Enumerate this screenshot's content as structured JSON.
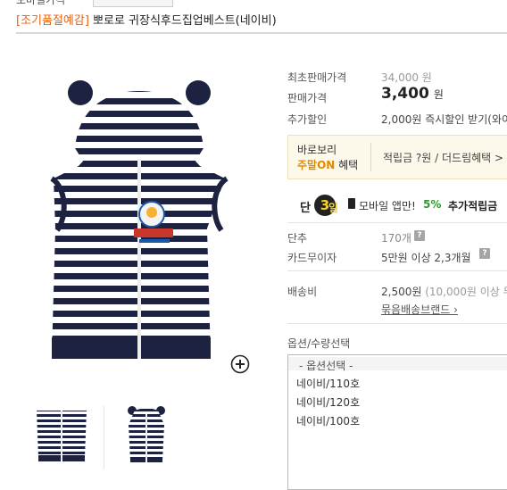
{
  "top": {
    "crumb": "모바일가격",
    "crumb_button": ""
  },
  "product": {
    "tag": "[조기품절예감]",
    "name": " 뽀로로 귀장식후드집업베스트(네이비)"
  },
  "price": {
    "original_label": "최초판매가격",
    "original_value": "34,000 원",
    "sale_label": "판매가격",
    "sale_value": "3,400",
    "sale_unit": "원",
    "extra_label": "추가할인",
    "extra_value": "2,000원 즉시할인 받기(와이"
  },
  "promo": {
    "line1": "바로보리",
    "line2_accent": "주말ON",
    "line2_rest": " 혜택",
    "right_text": "적립금 ?원 / 더드림혜택 >"
  },
  "mobile": {
    "dan": "단",
    "num": "3",
    "il": "일",
    "text_prefix": "모바일 앱만!",
    "percent": "5%",
    "text_suffix": "추가적립금"
  },
  "stock": {
    "label": "단추",
    "value": "170개"
  },
  "card": {
    "label": "카드무이자",
    "value": "5만원 이상 2,3개월"
  },
  "shipping": {
    "label": "배송비",
    "value": "2,500원",
    "note": "(10,000원 이상 무",
    "bundle_link": "묶음배송브랜드 ›"
  },
  "options": {
    "title": "옵션/수량선택",
    "header": "- 옵션선택 -",
    "items": [
      "네이비/110호",
      "네이비/120호",
      "네이비/100호"
    ]
  },
  "icons": {
    "question": "?",
    "zoom": "zoom-plus-icon"
  },
  "colors": {
    "accent_orange": "#e8610c",
    "green": "#2e9b2e",
    "navy": "#1c2240"
  }
}
